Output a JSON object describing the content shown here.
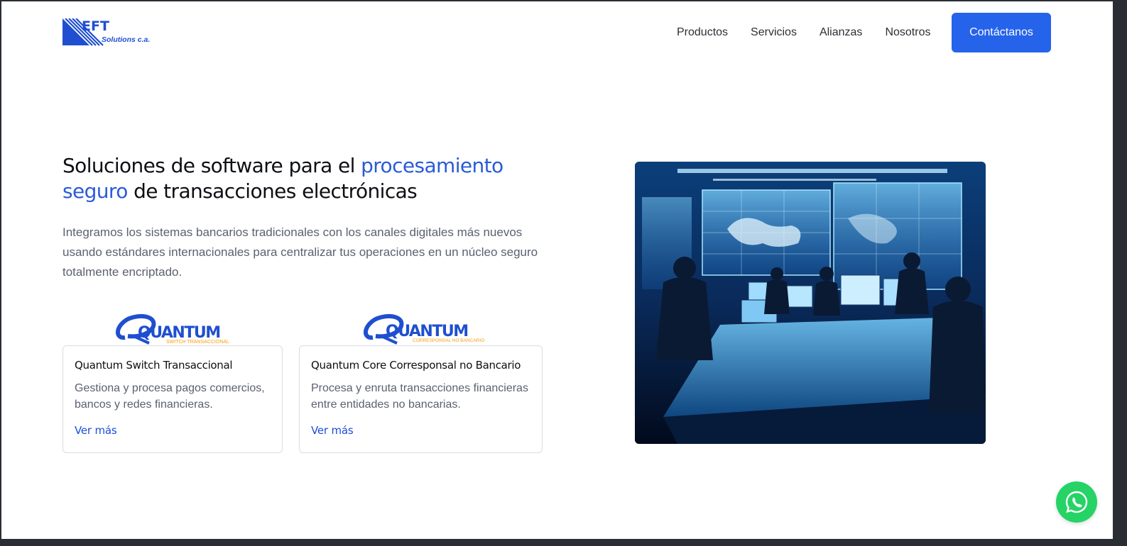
{
  "header": {
    "logo": {
      "brand": "EFT",
      "tagline": "Solutions c.a."
    },
    "nav": [
      {
        "label": "Productos"
      },
      {
        "label": "Servicios"
      },
      {
        "label": "Alianzas"
      },
      {
        "label": "Nosotros"
      }
    ],
    "contact_label": "Contáctanos"
  },
  "hero": {
    "title_part1": "Soluciones de software para el ",
    "title_accent1": "procesamiento",
    "title_accent2": "seguro",
    "title_part2": " de transacciones electrónicas",
    "description": "Integramos los sistemas bancarios tradicionales con los canales digitales más nuevos usando estándares internacionales para centralizar tus operaciones en un núcleo seguro totalmente encriptado."
  },
  "products": [
    {
      "logo_word": "QUANTUM",
      "logo_sub": "SWITCH TRANSACCIONAL",
      "title": "Quantum Switch Transaccional",
      "description": "Gestiona y procesa pagos comercios, bancos y redes financieras.",
      "link": "Ver más"
    },
    {
      "logo_word": "QUANTUM",
      "logo_sub": "CORRESPONSAL NO BANCARIO",
      "title": "Quantum Core Corresponsal no Bancario",
      "description": "Procesa y enruta transacciones financieras entre entidades no bancarias.",
      "link": "Ver más"
    }
  ],
  "hero_image": {
    "icon": "operations-room-photo"
  },
  "whatsapp": {
    "icon": "whatsapp-icon"
  },
  "colors": {
    "accent": "#2a5bd7",
    "button": "#2563eb",
    "logo_blue": "#1f4fd0",
    "logo_orange": "#f59e0b",
    "whatsapp": "#25d366"
  }
}
